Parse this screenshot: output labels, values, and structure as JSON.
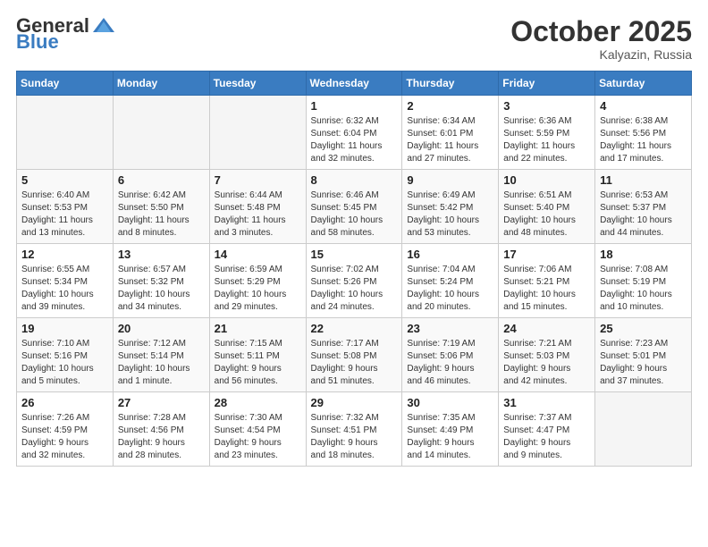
{
  "header": {
    "logo_general": "General",
    "logo_blue": "Blue",
    "month": "October 2025",
    "location": "Kalyazin, Russia"
  },
  "days_of_week": [
    "Sunday",
    "Monday",
    "Tuesday",
    "Wednesday",
    "Thursday",
    "Friday",
    "Saturday"
  ],
  "weeks": [
    [
      {
        "day": "",
        "info": ""
      },
      {
        "day": "",
        "info": ""
      },
      {
        "day": "",
        "info": ""
      },
      {
        "day": "1",
        "info": "Sunrise: 6:32 AM\nSunset: 6:04 PM\nDaylight: 11 hours\nand 32 minutes."
      },
      {
        "day": "2",
        "info": "Sunrise: 6:34 AM\nSunset: 6:01 PM\nDaylight: 11 hours\nand 27 minutes."
      },
      {
        "day": "3",
        "info": "Sunrise: 6:36 AM\nSunset: 5:59 PM\nDaylight: 11 hours\nand 22 minutes."
      },
      {
        "day": "4",
        "info": "Sunrise: 6:38 AM\nSunset: 5:56 PM\nDaylight: 11 hours\nand 17 minutes."
      }
    ],
    [
      {
        "day": "5",
        "info": "Sunrise: 6:40 AM\nSunset: 5:53 PM\nDaylight: 11 hours\nand 13 minutes."
      },
      {
        "day": "6",
        "info": "Sunrise: 6:42 AM\nSunset: 5:50 PM\nDaylight: 11 hours\nand 8 minutes."
      },
      {
        "day": "7",
        "info": "Sunrise: 6:44 AM\nSunset: 5:48 PM\nDaylight: 11 hours\nand 3 minutes."
      },
      {
        "day": "8",
        "info": "Sunrise: 6:46 AM\nSunset: 5:45 PM\nDaylight: 10 hours\nand 58 minutes."
      },
      {
        "day": "9",
        "info": "Sunrise: 6:49 AM\nSunset: 5:42 PM\nDaylight: 10 hours\nand 53 minutes."
      },
      {
        "day": "10",
        "info": "Sunrise: 6:51 AM\nSunset: 5:40 PM\nDaylight: 10 hours\nand 48 minutes."
      },
      {
        "day": "11",
        "info": "Sunrise: 6:53 AM\nSunset: 5:37 PM\nDaylight: 10 hours\nand 44 minutes."
      }
    ],
    [
      {
        "day": "12",
        "info": "Sunrise: 6:55 AM\nSunset: 5:34 PM\nDaylight: 10 hours\nand 39 minutes."
      },
      {
        "day": "13",
        "info": "Sunrise: 6:57 AM\nSunset: 5:32 PM\nDaylight: 10 hours\nand 34 minutes."
      },
      {
        "day": "14",
        "info": "Sunrise: 6:59 AM\nSunset: 5:29 PM\nDaylight: 10 hours\nand 29 minutes."
      },
      {
        "day": "15",
        "info": "Sunrise: 7:02 AM\nSunset: 5:26 PM\nDaylight: 10 hours\nand 24 minutes."
      },
      {
        "day": "16",
        "info": "Sunrise: 7:04 AM\nSunset: 5:24 PM\nDaylight: 10 hours\nand 20 minutes."
      },
      {
        "day": "17",
        "info": "Sunrise: 7:06 AM\nSunset: 5:21 PM\nDaylight: 10 hours\nand 15 minutes."
      },
      {
        "day": "18",
        "info": "Sunrise: 7:08 AM\nSunset: 5:19 PM\nDaylight: 10 hours\nand 10 minutes."
      }
    ],
    [
      {
        "day": "19",
        "info": "Sunrise: 7:10 AM\nSunset: 5:16 PM\nDaylight: 10 hours\nand 5 minutes."
      },
      {
        "day": "20",
        "info": "Sunrise: 7:12 AM\nSunset: 5:14 PM\nDaylight: 10 hours\nand 1 minute."
      },
      {
        "day": "21",
        "info": "Sunrise: 7:15 AM\nSunset: 5:11 PM\nDaylight: 9 hours\nand 56 minutes."
      },
      {
        "day": "22",
        "info": "Sunrise: 7:17 AM\nSunset: 5:08 PM\nDaylight: 9 hours\nand 51 minutes."
      },
      {
        "day": "23",
        "info": "Sunrise: 7:19 AM\nSunset: 5:06 PM\nDaylight: 9 hours\nand 46 minutes."
      },
      {
        "day": "24",
        "info": "Sunrise: 7:21 AM\nSunset: 5:03 PM\nDaylight: 9 hours\nand 42 minutes."
      },
      {
        "day": "25",
        "info": "Sunrise: 7:23 AM\nSunset: 5:01 PM\nDaylight: 9 hours\nand 37 minutes."
      }
    ],
    [
      {
        "day": "26",
        "info": "Sunrise: 7:26 AM\nSunset: 4:59 PM\nDaylight: 9 hours\nand 32 minutes."
      },
      {
        "day": "27",
        "info": "Sunrise: 7:28 AM\nSunset: 4:56 PM\nDaylight: 9 hours\nand 28 minutes."
      },
      {
        "day": "28",
        "info": "Sunrise: 7:30 AM\nSunset: 4:54 PM\nDaylight: 9 hours\nand 23 minutes."
      },
      {
        "day": "29",
        "info": "Sunrise: 7:32 AM\nSunset: 4:51 PM\nDaylight: 9 hours\nand 18 minutes."
      },
      {
        "day": "30",
        "info": "Sunrise: 7:35 AM\nSunset: 4:49 PM\nDaylight: 9 hours\nand 14 minutes."
      },
      {
        "day": "31",
        "info": "Sunrise: 7:37 AM\nSunset: 4:47 PM\nDaylight: 9 hours\nand 9 minutes."
      },
      {
        "day": "",
        "info": ""
      }
    ]
  ]
}
